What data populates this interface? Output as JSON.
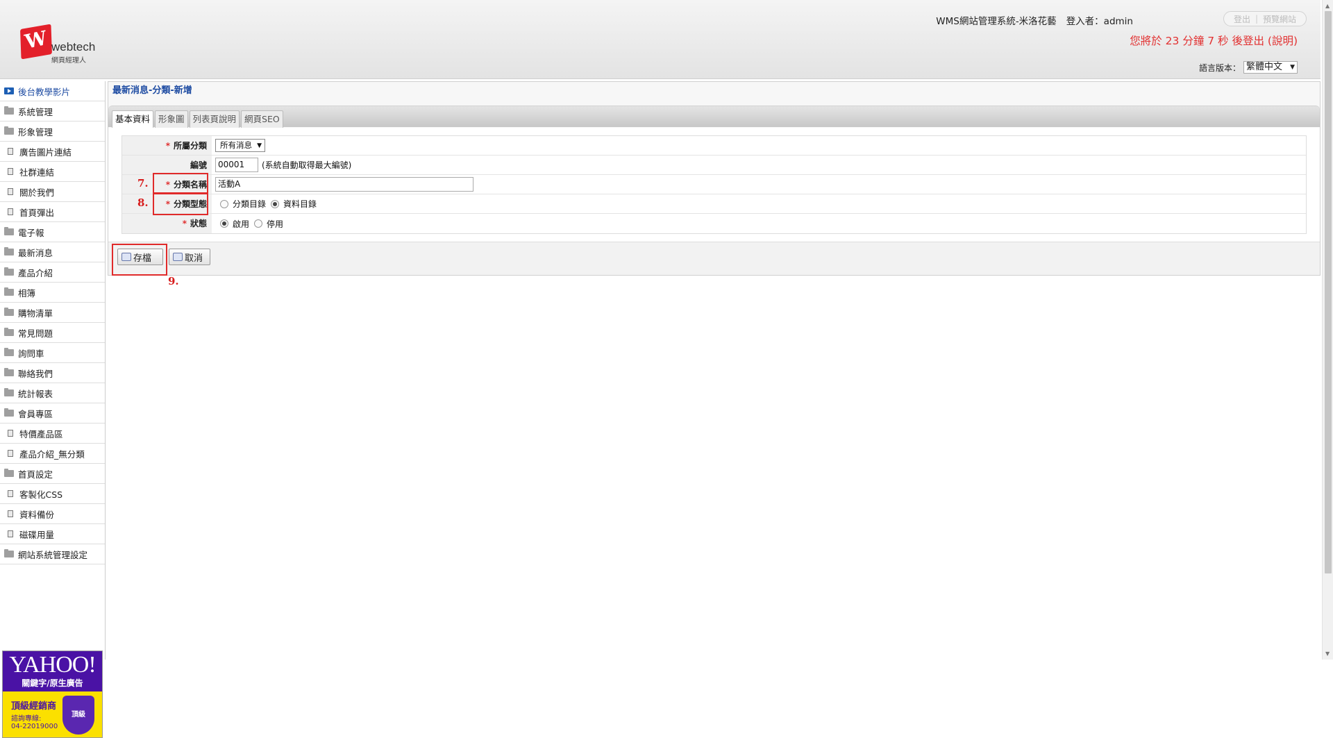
{
  "header": {
    "logo_text": "webtech",
    "logo_sub": "網頁經理人",
    "system_name": "WMS網站管理系統-米洛花藝",
    "login_label": "登入者：admin",
    "logout_link": "登出",
    "preview_link": "預覽網站",
    "countdown": "您將於 23 分鐘 7 秒 後登出 (說明)",
    "lang_label": "語言版本：",
    "lang_value": "繁體中文"
  },
  "sidebar": {
    "items": [
      {
        "label": "後台教學影片",
        "icon": "play-icon"
      },
      {
        "label": "系統管理",
        "icon": "folder-icon"
      },
      {
        "label": "形象管理",
        "icon": "folder-icon"
      },
      {
        "label": "廣告圖片連結",
        "icon": "page-icon"
      },
      {
        "label": "社群連結",
        "icon": "page-icon"
      },
      {
        "label": "關於我們",
        "icon": "page-icon"
      },
      {
        "label": "首頁彈出",
        "icon": "page-icon"
      },
      {
        "label": "電子報",
        "icon": "folder-icon"
      },
      {
        "label": "最新消息",
        "icon": "folder-icon"
      },
      {
        "label": "產品介紹",
        "icon": "folder-icon"
      },
      {
        "label": "相簿",
        "icon": "folder-icon"
      },
      {
        "label": "購物清單",
        "icon": "folder-icon"
      },
      {
        "label": "常見問題",
        "icon": "folder-icon"
      },
      {
        "label": "詢問車",
        "icon": "folder-icon"
      },
      {
        "label": "聯絡我們",
        "icon": "folder-icon"
      },
      {
        "label": "統計報表",
        "icon": "folder-icon"
      },
      {
        "label": "會員專區",
        "icon": "folder-icon"
      },
      {
        "label": "特價產品區",
        "icon": "page-icon"
      },
      {
        "label": "產品介紹_無分類",
        "icon": "page-icon"
      },
      {
        "label": "首頁設定",
        "icon": "folder-icon"
      },
      {
        "label": "客製化CSS",
        "icon": "page-icon"
      },
      {
        "label": "資料備份",
        "icon": "page-icon"
      },
      {
        "label": "磁碟用量",
        "icon": "page-icon"
      },
      {
        "label": "網站系統管理設定",
        "icon": "folder-icon"
      }
    ],
    "ad": {
      "brand": "YAHOO!",
      "headline": "關鍵字/原生廣告",
      "reseller": "頂級經銷商",
      "hotline_label": "諮詢專線:",
      "hotline": "04-22019000",
      "badge": "頂級"
    }
  },
  "main": {
    "title": "最新消息-分類-新增",
    "tabs": [
      "基本資料",
      "形象圖",
      "列表頁說明",
      "網頁SEO"
    ],
    "form": {
      "category_label": "所屬分類",
      "category_value": "所有消息",
      "number_label": "編號",
      "number_value": "00001",
      "number_hint": "(系統自動取得最大編號)",
      "name_label": "分類名稱",
      "name_value": "活動A",
      "type_label": "分類型態",
      "type_opt1": "分類目錄",
      "type_opt2": "資料目錄",
      "status_label": "狀態",
      "status_opt1": "啟用",
      "status_opt2": "停用",
      "required_mark": "*"
    },
    "buttons": {
      "save": "存檔",
      "cancel": "取消"
    }
  },
  "annotations": {
    "n7": "7.",
    "n8": "8.",
    "n9": "9."
  },
  "colors": {
    "accent_blue": "#1d4ba2",
    "alert_red": "#e23030",
    "annotation_red": "#e02a2a"
  }
}
